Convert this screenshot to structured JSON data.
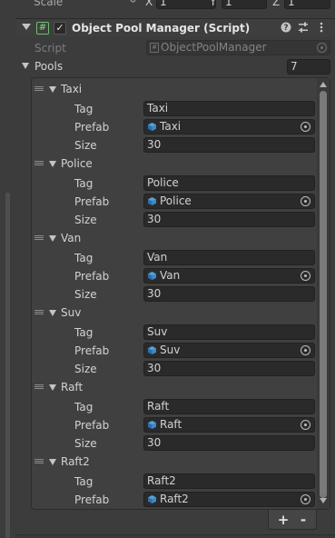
{
  "transform": {
    "scale_label": "Scale",
    "axes": [
      {
        "axis": "X",
        "value": "1"
      },
      {
        "axis": "Y",
        "value": "1"
      },
      {
        "axis": "Z",
        "value": "1"
      }
    ]
  },
  "component": {
    "title": "Object Pool Manager (Script)",
    "enabled_check": "✓",
    "script_label": "Script",
    "script_value": "ObjectPoolManager"
  },
  "pools": {
    "label": "Pools",
    "count": "7",
    "tag_label": "Tag",
    "prefab_label": "Prefab",
    "size_label": "Size",
    "entries": [
      {
        "name": "Taxi",
        "tag": "Taxi",
        "prefab": "Taxi",
        "size": "30"
      },
      {
        "name": "Police",
        "tag": "Police",
        "prefab": "Police",
        "size": "30"
      },
      {
        "name": "Van",
        "tag": "Van",
        "prefab": "Van",
        "size": "30"
      },
      {
        "name": "Suv",
        "tag": "Suv",
        "prefab": "Suv",
        "size": "30"
      },
      {
        "name": "Raft",
        "tag": "Raft",
        "prefab": "Raft",
        "size": "30"
      },
      {
        "name": "Raft2",
        "tag": "Raft2",
        "prefab": "Raft2",
        "size": ""
      }
    ]
  },
  "footer": {
    "add_label": "+",
    "remove_label": "-"
  },
  "icons": {
    "prefab": "prefab-cube-icon",
    "script": "script-hash-icon",
    "help": "help-icon",
    "presets": "presets-icon",
    "menu": "kebab-menu-icon",
    "target": "object-picker-icon"
  },
  "colors": {
    "prefab_icon": "#4fa3e0",
    "script_icon": "#6fbf6f"
  }
}
